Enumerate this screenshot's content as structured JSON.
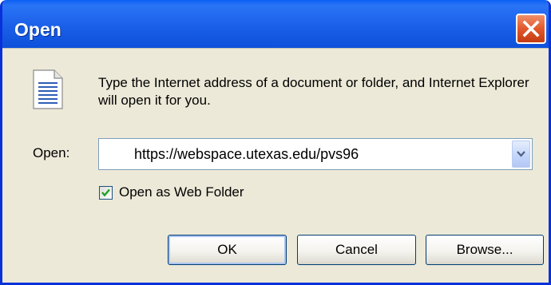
{
  "window": {
    "title": "Open"
  },
  "message": "Type the Internet address of a document or folder, and Internet Explorer will open it for you.",
  "open_field": {
    "label": "Open:",
    "value": "https://webspace.utexas.edu/pvs96"
  },
  "web_folder_checkbox": {
    "label": "Open as Web Folder",
    "checked": true
  },
  "buttons": {
    "ok": "OK",
    "cancel": "Cancel",
    "browse": "Browse..."
  },
  "icons": {
    "close": "close-icon",
    "document": "document-icon",
    "dropdown": "chevron-down-icon",
    "check": "checkmark-icon"
  },
  "colors": {
    "title_bar": "#0a5ff3",
    "close_button": "#e2582c",
    "dialog_background": "#ece9d8",
    "button_border": "#003c74"
  }
}
